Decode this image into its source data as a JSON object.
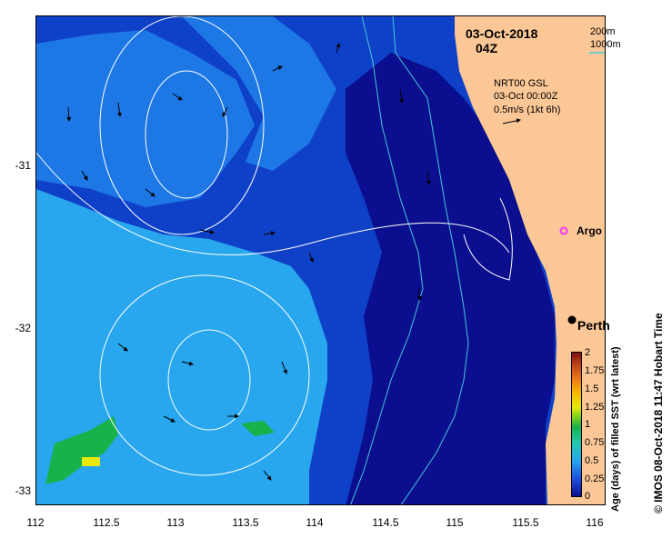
{
  "map": {
    "date": "03-Oct-2018",
    "time": "04Z",
    "isobath_200": "200m",
    "isobath_1000": "1000m",
    "model": "NRT00 GSL",
    "model_time": "03-Oct 00:00Z",
    "vector_scale": "0.5m/s (1kt 6h)",
    "argo_label": "Argo",
    "city_label": "Perth",
    "x_ticks": [
      "112",
      "112.5",
      "113",
      "113.5",
      "114",
      "114.5",
      "115",
      "115.5",
      "116"
    ],
    "y_ticks": [
      "-31",
      "-32",
      "-33"
    ],
    "colorbar_label": "Age (days) of filled SST (wrt latest)",
    "colorbar_ticks": [
      "2",
      "1.75",
      "1.5",
      "1.25",
      "1",
      "0.75",
      "0.5",
      "0.25",
      "0"
    ],
    "credit": "© IMOS 08-Oct-2018 11:47 Hobart Time",
    "colors": {
      "land": "#fbc796",
      "deep_navy": "#0b0e8e",
      "mid_blue": "#0f41c8",
      "bright_blue": "#1d78e6",
      "light_blue": "#28a6ee",
      "isobath": "#45c9d9",
      "argo": "#ff33ff",
      "green": "#18b24a",
      "yellow": "#e8e80a"
    }
  }
}
